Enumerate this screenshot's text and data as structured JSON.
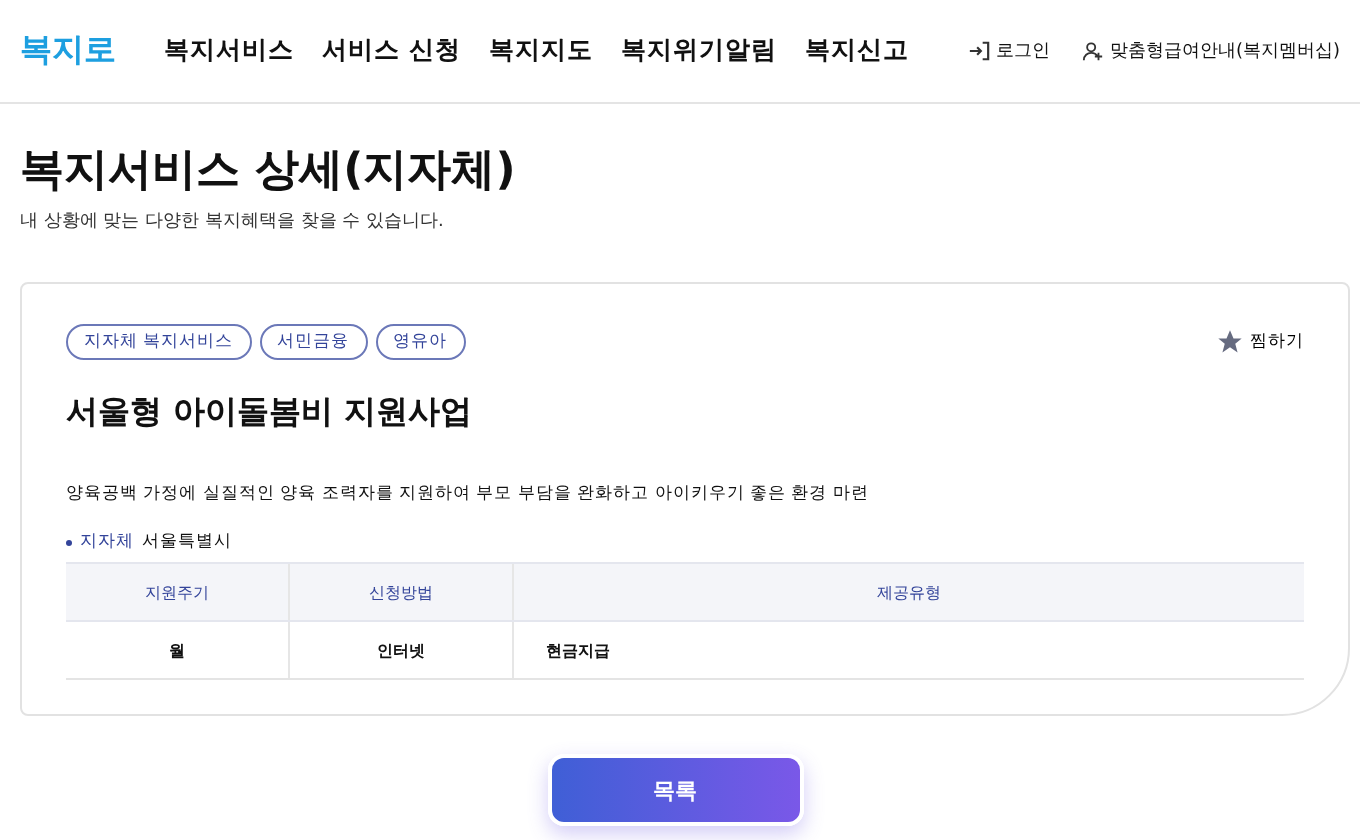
{
  "header": {
    "logo": "복지로",
    "nav": [
      "복지서비스",
      "서비스 신청",
      "복지지도",
      "복지위기알림",
      "복지신고"
    ],
    "login": "로그인",
    "membership": "맞춤형급여안내(복지멤버십)"
  },
  "page": {
    "title": "복지서비스 상세(지자체)",
    "subtitle": "내 상황에 맞는 다양한 복지혜택을 찾을 수 있습니다."
  },
  "card": {
    "tags": [
      "지자체 복지서비스",
      "서민금융",
      "영유아"
    ],
    "bookmark": {
      "label": "찜하기",
      "selected": false
    },
    "title": "서울형 아이돌봄비 지원사업",
    "description": "양육공백 가정에 실질적인 양육 조력자를 지원하여 부모 부담을 완화하고 아이키우기 좋은 환경 마련",
    "info": {
      "label": "지자체",
      "value": "서울특별시"
    },
    "table": {
      "columns": [
        "지원주기",
        "신청방법",
        "제공유형"
      ],
      "rows": [
        [
          "월",
          "인터넷",
          "현금지급"
        ]
      ]
    }
  },
  "button": "목록"
}
